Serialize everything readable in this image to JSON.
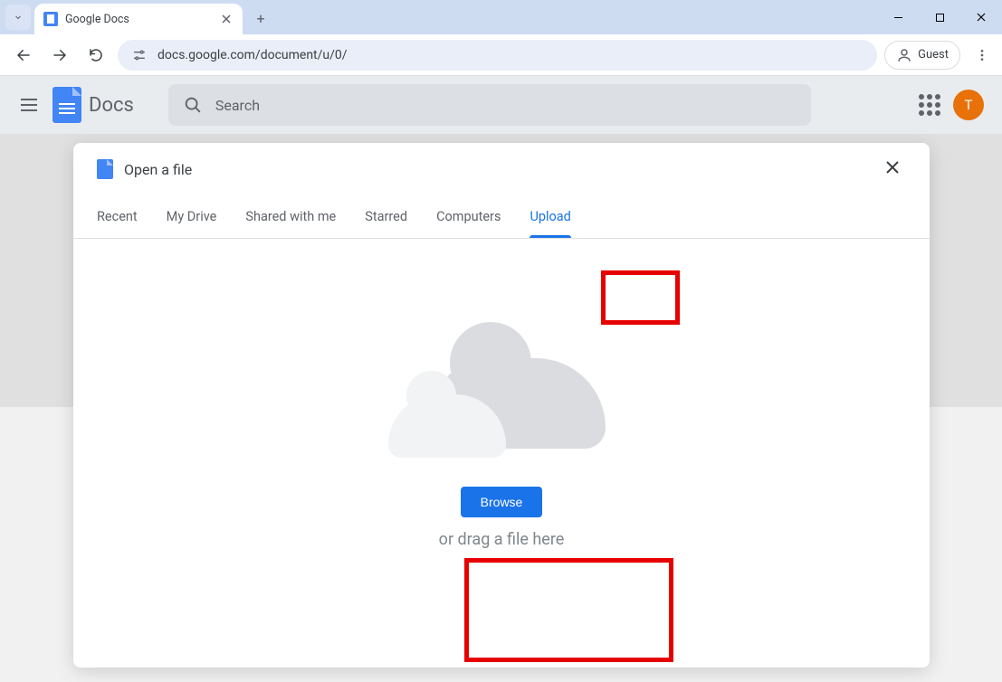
{
  "browser": {
    "tab_title": "Google Docs",
    "url": "docs.google.com/document/u/0/",
    "guest_label": "Guest"
  },
  "docs": {
    "app_title": "Docs",
    "search_placeholder": "Search",
    "avatar_initial": "T"
  },
  "dialog": {
    "title": "Open a file",
    "tabs": [
      "Recent",
      "My Drive",
      "Shared with me",
      "Starred",
      "Computers",
      "Upload"
    ],
    "active_tab_index": 5,
    "browse_label": "Browse",
    "drag_text": "or drag a file here"
  }
}
